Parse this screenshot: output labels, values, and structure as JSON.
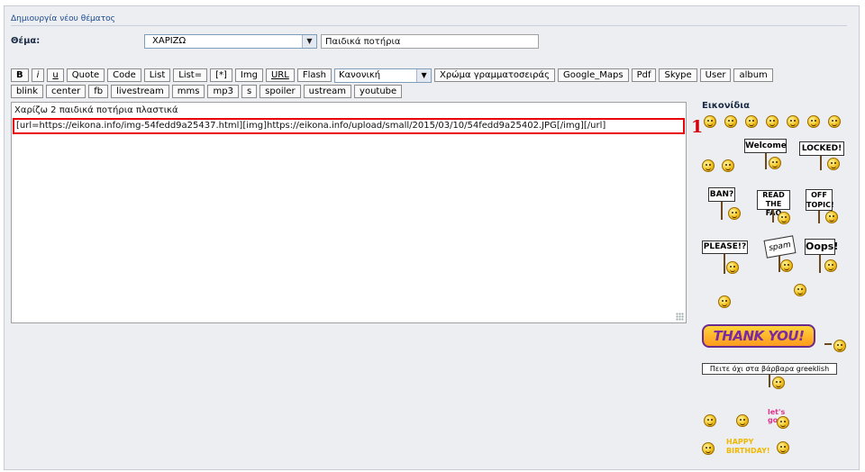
{
  "header": {
    "title": "Δημιουργία νέου θέματος"
  },
  "subject": {
    "label": "Θέμα:",
    "category_select": "ΧΑΡΙΖΩ",
    "title_value": "Παιδικά ποτήρια"
  },
  "toolbar": {
    "row1": [
      "B",
      "i",
      "u",
      "Quote",
      "Code",
      "List",
      "List=",
      "[*]",
      "Img",
      "URL",
      "Flash"
    ],
    "font_select": "Κανονική",
    "row1_after": [
      "Χρώμα γραμματοσειράς",
      "Google_Maps",
      "Pdf",
      "Skype",
      "User",
      "album"
    ],
    "row2": [
      "blink",
      "center",
      "fb",
      "livestream",
      "mms",
      "mp3",
      "s",
      "spoiler",
      "ustream",
      "youtube"
    ]
  },
  "editor": {
    "line1": "Χαρίζω 2 παιδικά ποτήρια πλαστικά",
    "line2": "[url=https://eikona.info/img-54fedd9a25437.html][img]https://eikona.info/upload/small/2015/03/10/54fedd9a25402.JPG[/img][/url]"
  },
  "annotation": {
    "marker": "1"
  },
  "smilies": {
    "title": "Εικονίδια",
    "signs": [
      "Welcome",
      "LOCKED!",
      "BAN?",
      "READ THE FAQ",
      "OFF TOPIC!",
      "PLEASE!?",
      "spam",
      "Oops!"
    ],
    "thank_you": "THANK YOU!",
    "greeklish": "Πειτε όχι στα βάρβαρα greeklish",
    "lets_go": "let's go",
    "birthday": "HAPPY BIRTHDAY!"
  },
  "colors": {
    "highlight_border": "#e8000b",
    "header_link": "#1b4a8c"
  }
}
